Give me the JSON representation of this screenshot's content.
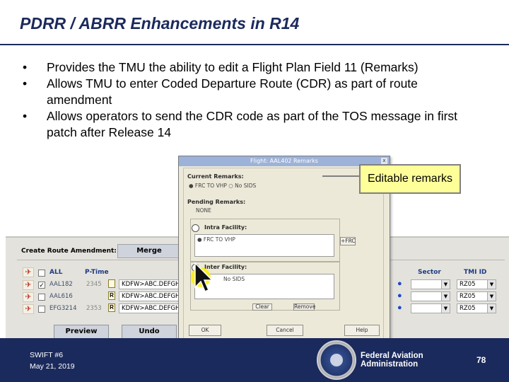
{
  "slide": {
    "title": "PDRR / ABRR Enhancements in R14",
    "bullets": [
      "Provides the TMU the ability to edit a Flight Plan Field 11 (Remarks)",
      "Allows TMU to enter Coded Departure Route (CDR) as part of route amendment",
      "Allows operators to send the CDR code as part of the TOS message in first patch after Release 14"
    ]
  },
  "callout": {
    "text": "Editable remarks"
  },
  "amendment_panel": {
    "label": "Create Route Amendment:",
    "merge_label": "Merge",
    "headers": {
      "all": "ALL",
      "ptime": "P-Time",
      "sector": "Sector",
      "tmi": "TMI ID"
    },
    "rows": [
      {
        "flight": "AAL182",
        "ptime": "2345",
        "route": "KDFW>ABC.DEFGH.",
        "sector": "",
        "tmi": "RZ05",
        "checked": "✓",
        "flag": ""
      },
      {
        "flight": "AAL616",
        "ptime": "",
        "route": "KDFW>ABC.DEFGH.",
        "sector": "",
        "tmi": "RZ05",
        "checked": "",
        "flag": "R"
      },
      {
        "flight": "EFG3214",
        "ptime": "2353",
        "route": "KDFW>ABC.DEFGH.",
        "sector": "",
        "tmi": "RZ05",
        "checked": "",
        "flag": "R"
      }
    ],
    "preview_label": "Preview",
    "undo_label": "Undo"
  },
  "dialog": {
    "title": "Flight: AAL402 Remarks",
    "close": "x",
    "current_label": "Current Remarks:",
    "current_value": "● FRC TO VHP  ○ No SIDS",
    "pending_label": "Pending Remarks:",
    "pending_value": "NONE",
    "intra_label": "Intra Facility:",
    "intra_value": "● FRC TO VHP",
    "frc_btn": "+FRC",
    "inter_label": "Inter Facility:",
    "inter_value": "No SIDS",
    "clear_btn": "Clear",
    "remove_btn": "Remove",
    "ok_btn": "OK",
    "cancel_btn": "Cancel",
    "help_btn": "Help"
  },
  "footer": {
    "event": "SWIFT #6",
    "date": "May 21, 2019",
    "org_line1": "Federal Aviation",
    "org_line2": "Administration",
    "page": "78"
  },
  "colors": {
    "brand_navy": "#1b2a5c",
    "callout_yellow": "#ffff99",
    "cursor_yellow": "#ffee00"
  },
  "icons": [
    "plane-icon",
    "checkbox-icon",
    "map-pin-icon",
    "dropdown-arrow-icon",
    "mouse-cursor-icon",
    "faa-seal-icon",
    "close-icon",
    "radio-icon"
  ]
}
